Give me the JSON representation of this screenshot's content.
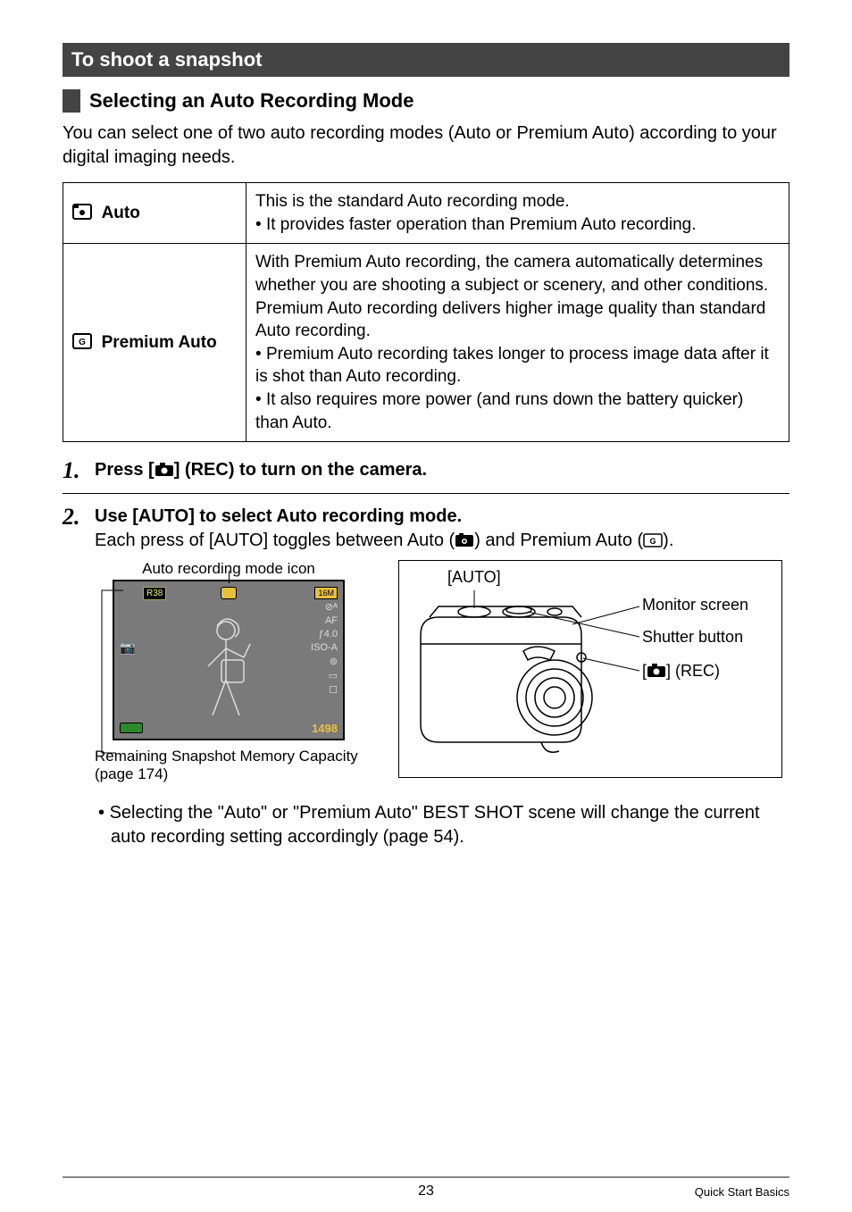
{
  "section_title": "To shoot a snapshot",
  "subheading": "Selecting an Auto Recording Mode",
  "intro": "You can select one of two auto recording modes (Auto or Premium Auto) according to your digital imaging needs.",
  "table": {
    "rows": [
      {
        "icon": "auto-mode-icon",
        "label": "Auto",
        "desc_main": "This is the standard Auto recording mode.",
        "bullets": [
          "It provides faster operation than Premium Auto recording."
        ]
      },
      {
        "icon": "premium-auto-mode-icon",
        "label": "Premium Auto",
        "desc_main": "With Premium Auto recording, the camera automatically determines whether you are shooting a subject or scenery, and other conditions. Premium Auto recording delivers higher image quality than standard Auto recording.",
        "bullets": [
          "Premium Auto recording takes longer to process image data after it is shot than Auto recording.",
          "It also requires more power (and runs down the battery quicker) than Auto."
        ]
      }
    ]
  },
  "steps": [
    {
      "num": "1.",
      "title_pre": "Press [",
      "title_post": "] (REC) to turn on the camera.",
      "title_icon": "camera-rec-icon"
    },
    {
      "num": "2.",
      "title": "Use [AUTO] to select Auto recording mode.",
      "body_pre": "Each press of [AUTO] toggles between Auto (",
      "body_mid": ") and Premium Auto (",
      "body_post": ").",
      "icon1": "auto-mode-icon-small",
      "icon2": "premium-auto-mode-icon-small"
    }
  ],
  "left_figure": {
    "caption_top": "Auto recording mode icon",
    "caption_bottom": "Remaining Snapshot Memory Capacity (page 174)",
    "counter_value": "R38",
    "badge_value": "16M",
    "bottom_number": "1498",
    "right_icons": [
      "⊘ᴬ",
      "AF",
      "ƒ4.0",
      "ISO-A",
      "⊚",
      "▭",
      "☐"
    ]
  },
  "right_figure": {
    "auto_label": "[AUTO]",
    "callouts": {
      "monitor": "Monitor screen",
      "shutter": "Shutter button",
      "rec_pre": "[",
      "rec_post": "] (REC)"
    }
  },
  "note_bullet": "Selecting the \"Auto\" or \"Premium Auto\" BEST SHOT scene will change the current auto recording setting accordingly (page 54).",
  "footer": {
    "page_number": "23",
    "section_label": "Quick Start Basics"
  }
}
